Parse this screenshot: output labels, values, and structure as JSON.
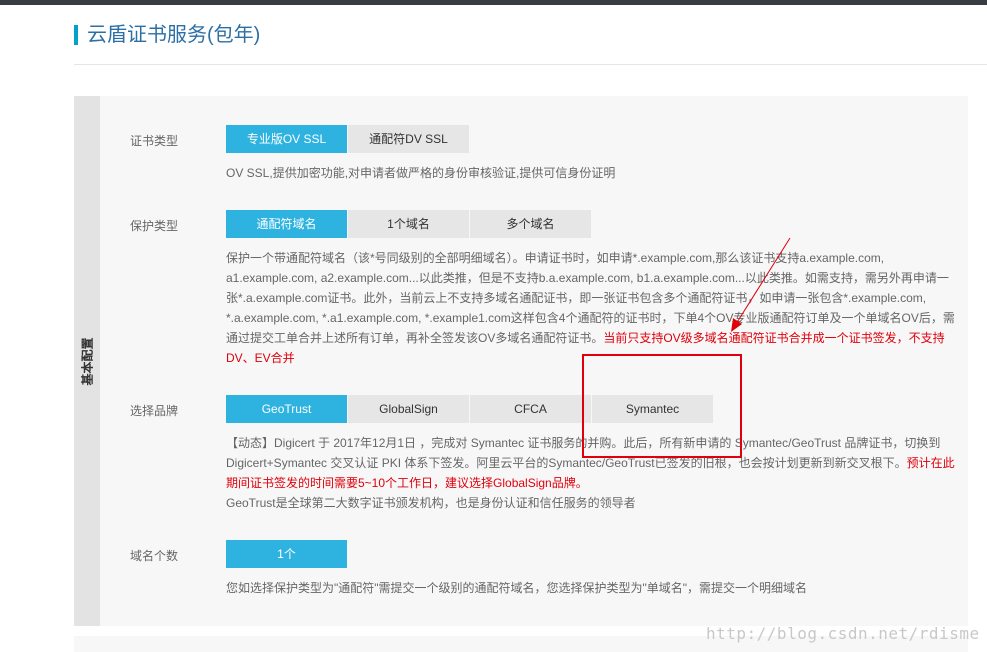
{
  "page": {
    "title": "云盾证书服务(包年)",
    "side_label": "基本配置"
  },
  "cert_type": {
    "label": "证书类型",
    "options": [
      "专业版OV SSL",
      "通配符DV SSL"
    ],
    "selected": "专业版OV SSL",
    "description": "OV SSL,提供加密功能,对申请者做严格的身份审核验证,提供可信身份证明"
  },
  "protect_type": {
    "label": "保护类型",
    "options": [
      "通配符域名",
      "1个域名",
      "多个域名"
    ],
    "selected": "通配符域名",
    "description": "保护一个带通配符域名（该*号同级别的全部明细域名）。申请证书时，如申请*.example.com,那么该证书支持a.example.com, a1.example.com, a2.example.com...以此类推，但是不支持b.a.example.com, b1.a.example.com...以此类推。如需支持，需另外再申请一张*.a.example.com证书。此外，当前云上不支持多域名通配证书，即一张证书包含多个通配符证书，如申请一张包含*.example.com, *.a.example.com, *.a1.example.com, *.example1.com这样包含4个通配符的证书时，下单4个OV专业版通配符订单及一个单域名OV后，需通过提交工单合并上述所有订单，再补全签发该OV多域名通配符证书。",
    "notice_red": "当前只支持OV级多域名通配符证书合并成一个证书签发，不支持DV、EV合并"
  },
  "brand": {
    "label": "选择品牌",
    "options": [
      "GeoTrust",
      "GlobalSign",
      "CFCA",
      "Symantec"
    ],
    "selected": "GeoTrust",
    "news": "【动态】Digicert 于 2017年12月1日 ，完成对 Symantec 证书服务的并购。此后，所有新申请的 Symantec/GeoTrust 品牌证书，切换到 Digicert+Symantec 交叉认证 PKI 体系下签发。阿里云平台的Symantec/GeoTrust已签发的旧根，也会按计划更新到新交叉根下。",
    "news_red": "预计在此期间证书签发的时间需要5~10个工作日，建议选择GlobalSign品牌。",
    "description": "GeoTrust是全球第二大数字证书颁发机构，也是身份认证和信任服务的领导者"
  },
  "domain_count": {
    "label": "域名个数",
    "value": "1个",
    "description": "您如选择保护类型为\"通配符\"需提交一个级别的通配符域名，您选择保护类型为\"单域名\"，需提交一个明细域名"
  },
  "watermark": "http://blog.csdn.net/rdisme",
  "colors": {
    "accent": "#2eb3e0",
    "title": "#2c6fa5",
    "annotation": "#e0000b"
  }
}
